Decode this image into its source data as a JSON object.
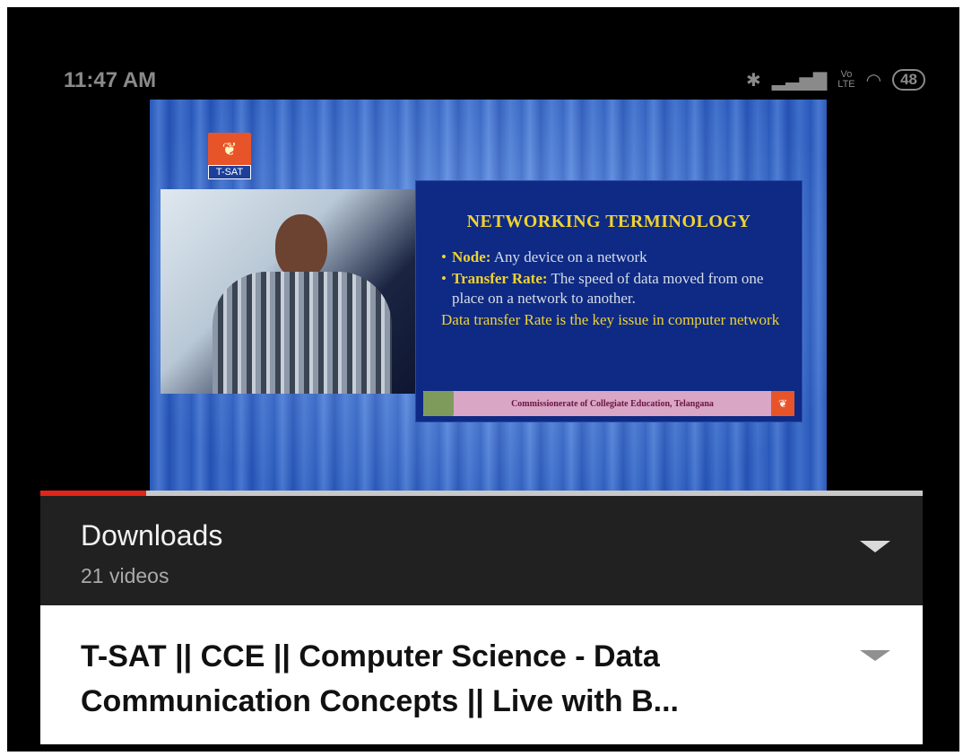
{
  "status_bar": {
    "time": "11:47 AM",
    "icons": [
      "bluetooth-icon",
      "signal-icon",
      "volte-icon",
      "wifi-icon"
    ],
    "battery": "48"
  },
  "video": {
    "channel_logo_text": "T-SAT",
    "slide": {
      "title": "NETWORKING TERMINOLOGY",
      "bullets": [
        {
          "term": "Node:",
          "text": " Any device on a network"
        },
        {
          "term": "Transfer Rate:",
          "text": " The speed of data moved from one place on a network to another."
        }
      ],
      "note": "Data transfer Rate is the key issue in computer network",
      "footer": "Commissionerate of Collegiate Education, Telangana"
    },
    "progress_fraction": 0.12,
    "progress_color": "#e0251b"
  },
  "playlist": {
    "title": "Downloads",
    "count": "21 videos"
  },
  "video_info": {
    "title": "T-SAT || CCE || Computer Science - Data Communication Concepts || Live with B..."
  }
}
